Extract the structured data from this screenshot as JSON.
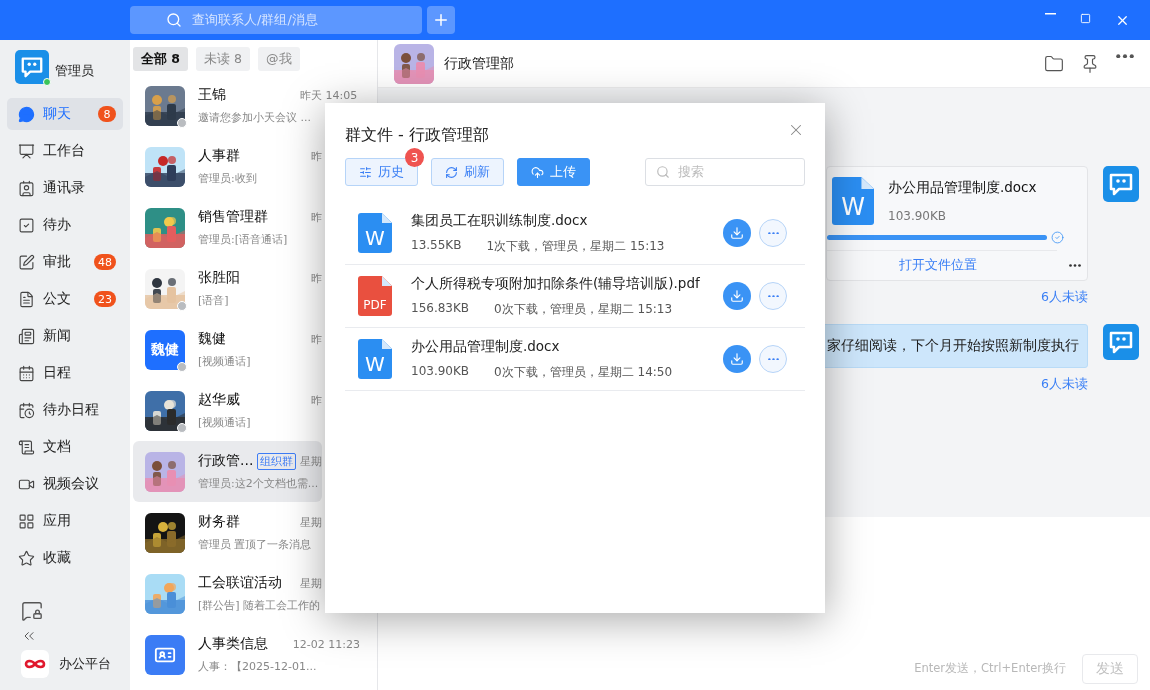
{
  "top_bar": {
    "search": {
      "placeholder": "查询联系人/群组/消息"
    }
  },
  "sidebar": {
    "user": {
      "name": "管理员",
      "online": true
    },
    "items": [
      {
        "label": "聊天",
        "badge": "8",
        "selected": true
      },
      {
        "label": "工作台",
        "selected": false
      },
      {
        "label": "通讯录",
        "selected": false
      },
      {
        "label": "待办",
        "selected": false
      },
      {
        "label": "审批",
        "badge": "48",
        "selected": false
      },
      {
        "label": "公文",
        "badge": "23",
        "selected": false
      },
      {
        "label": "新闻",
        "selected": false
      },
      {
        "label": "日程",
        "selected": false
      },
      {
        "label": "待办日程",
        "selected": false
      },
      {
        "label": "文档",
        "selected": false
      },
      {
        "label": "视频会议",
        "selected": false
      },
      {
        "label": "应用",
        "selected": false
      },
      {
        "label": "收藏",
        "selected": false
      }
    ],
    "platform": {
      "label": "办公平台"
    }
  },
  "chat_list": {
    "filters": [
      {
        "label": "全部 8",
        "selected": true
      },
      {
        "label": "未读 8",
        "selected": false
      },
      {
        "label": "@我",
        "selected": false
      }
    ],
    "chats": [
      {
        "name": "王锦",
        "time": "昨天 14:05",
        "preview": "邀请您参加小天会议 ...",
        "offline": true,
        "selected": false
      },
      {
        "name": "人事群",
        "time": "昨",
        "preview": "管理员:收到",
        "offline": false,
        "selected": false
      },
      {
        "name": "销售管理群",
        "time": "昨",
        "preview": "管理员:[语音通话]",
        "offline": false,
        "selected": false
      },
      {
        "name": "张胜阳",
        "time": "昨",
        "preview": "[语音]",
        "offline": true,
        "selected": false
      },
      {
        "name": "魏健",
        "time": "昨",
        "preview": "[视频通话]",
        "avatar": {
          "kind": "text",
          "text": "魏健"
        },
        "offline": true,
        "selected": false
      },
      {
        "name": "赵华威",
        "time": "昨",
        "preview": "[视频通话]",
        "offline": true,
        "selected": false
      },
      {
        "name": "行政管...",
        "tag": "组织群",
        "time": "星期",
        "preview": "管理员:这2个文档也需...",
        "offline": false,
        "selected": true
      },
      {
        "name": "财务群",
        "time": "星期",
        "preview": "管理员 置顶了一条消息",
        "offline": false,
        "selected": false
      },
      {
        "name": "工会联谊活动",
        "time": "星期",
        "preview": "[群公告] 随着工会工作的",
        "offline": false,
        "selected": false
      },
      {
        "name": "人事类信息",
        "time": "12-02 11:23",
        "preview": "人事：【2025-12-01...",
        "avatar": {
          "kind": "icon"
        },
        "offline": false,
        "selected": false
      }
    ]
  },
  "conversation": {
    "title": "行政管理部",
    "messages": [
      {
        "kind": "file",
        "icon_label": "W",
        "file_name": "办公用品管理制度.docx",
        "size": "103.90KB",
        "level": 1,
        "action": "打开文件位置",
        "receipt": "6人未读"
      },
      {
        "kind": "text",
        "text": "家仔细阅读，下个月开始按照新制度执行",
        "receipt": "6人未读"
      }
    ],
    "input": {
      "hint": "Enter发送，Ctrl+Enter换行",
      "send": {
        "label": "发送",
        "disabled": true
      }
    }
  },
  "dialog": {
    "title": "群文件 - 行政管理部",
    "toolbar": [
      {
        "kind": "history",
        "label": "历史",
        "badge": "3"
      },
      {
        "kind": "refresh",
        "label": "刷新"
      },
      {
        "kind": "upload",
        "label": "上传"
      }
    ],
    "search": {
      "placeholder": "搜索"
    },
    "files": [
      {
        "kind": "word",
        "icon_label": "W",
        "name": "集团员工在职训练制度.docx",
        "size": "13.55KB",
        "meta": "1次下载，管理员，星期二 15:13"
      },
      {
        "kind": "pdf",
        "icon_label": "PDF",
        "name": "个人所得税专项附加扣除条件(辅导培训版).pdf",
        "size": "156.83KB",
        "meta": "0次下载，管理员，星期二 15:13"
      },
      {
        "kind": "word",
        "icon_label": "W",
        "name": "办公用品管理制度.docx",
        "size": "103.90KB",
        "meta": "0次下载，管理员，星期二 14:50"
      }
    ]
  }
}
